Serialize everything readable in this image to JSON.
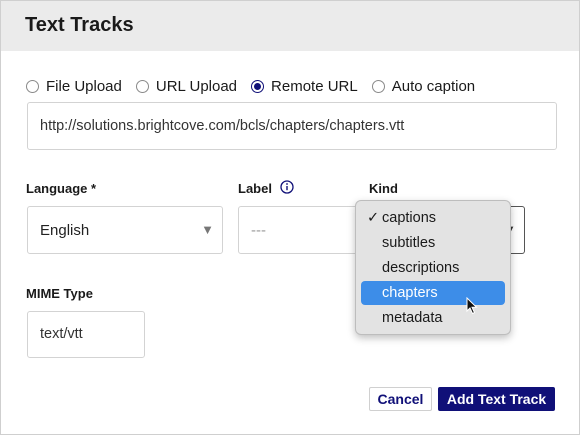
{
  "dialog": {
    "title": "Text Tracks"
  },
  "source_options": [
    {
      "label": "File Upload",
      "checked": false
    },
    {
      "label": "URL Upload",
      "checked": false
    },
    {
      "label": "Remote URL",
      "checked": true
    },
    {
      "label": "Auto caption",
      "checked": false
    }
  ],
  "url_input": {
    "value": "http://solutions.brightcove.com/bcls/chapters/chapters.vtt"
  },
  "language": {
    "label": "Language *",
    "value": "English"
  },
  "label_field": {
    "label": "Label",
    "value": "---"
  },
  "kind": {
    "label": "Kind",
    "options": [
      {
        "label": "captions",
        "checked": true,
        "highlighted": false
      },
      {
        "label": "subtitles",
        "checked": false,
        "highlighted": false
      },
      {
        "label": "descriptions",
        "checked": false,
        "highlighted": false
      },
      {
        "label": "chapters",
        "checked": false,
        "highlighted": true
      },
      {
        "label": "metadata",
        "checked": false,
        "highlighted": false
      }
    ],
    "check_glyph": "✓"
  },
  "mime": {
    "label": "MIME Type",
    "value": "text/vtt"
  },
  "buttons": {
    "cancel": "Cancel",
    "add": "Add Text Track"
  },
  "colors": {
    "accent": "#101078",
    "highlight": "#3d8de8",
    "header_bg": "#ebebeb"
  }
}
